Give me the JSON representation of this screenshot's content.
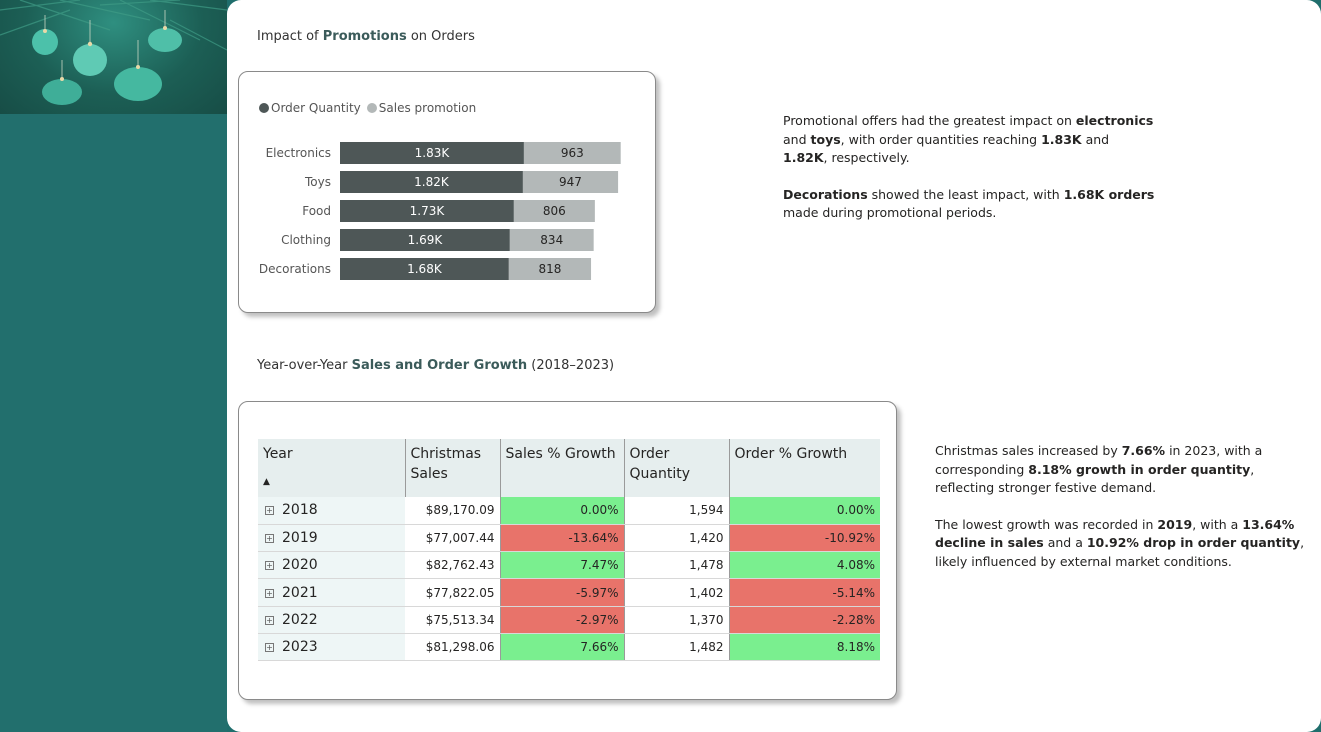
{
  "promo_section": {
    "title_pre": "Impact of ",
    "title_bold": "Promotions",
    "title_post": " on Orders"
  },
  "chart_data": {
    "type": "bar",
    "orientation": "horizontal",
    "stacked": true,
    "categories": [
      "Electronics",
      "Toys",
      "Food",
      "Clothing",
      "Decorations"
    ],
    "series": [
      {
        "name": "Order Quantity",
        "values": [
          1830,
          1820,
          1730,
          1690,
          1680
        ],
        "labels": [
          "1.83K",
          "1.82K",
          "1.73K",
          "1.69K",
          "1.68K"
        ],
        "color": "#4e5757",
        "label_color": "#ffffff"
      },
      {
        "name": "Sales promotion",
        "values": [
          963,
          947,
          806,
          834,
          818
        ],
        "labels": [
          "963",
          "947",
          "806",
          "834",
          "818"
        ],
        "color": "#b3b8b8",
        "label_color": "#252423"
      }
    ],
    "legend_position": "top-left",
    "grid": false
  },
  "promo_narrative": {
    "p1_a": "Promotional offers had the greatest impact on ",
    "p1_b": "electronics",
    "p1_c": " and ",
    "p1_d": "toys",
    "p1_e": ", with order quantities reaching ",
    "p1_f": "1.83K",
    "p1_g": " and ",
    "p1_h": "1.82K",
    "p1_i": ", respectively.",
    "p2_a": "Decorations",
    "p2_b": " showed the least impact, with ",
    "p2_c": "1.68K orders",
    "p2_d": " made during promotional periods."
  },
  "growth_section": {
    "title_pre": "Year-over-Year ",
    "title_bold": "Sales and Order Growth",
    "title_post": " (2018–2023)"
  },
  "growth_table": {
    "headers": [
      "Year",
      "Christmas Sales",
      "Sales % Growth",
      "Order Quantity",
      "Order % Growth"
    ],
    "sort_indicator": "▲",
    "expand_glyph": "+",
    "rows": [
      {
        "year": "2018",
        "sales": "$89,170.09",
        "sales_growth": "0.00%",
        "orders": "1,594",
        "order_growth": "0.00%",
        "sg": "pos",
        "og": "pos"
      },
      {
        "year": "2019",
        "sales": "$77,007.44",
        "sales_growth": "-13.64%",
        "orders": "1,420",
        "order_growth": "-10.92%",
        "sg": "neg",
        "og": "neg"
      },
      {
        "year": "2020",
        "sales": "$82,762.43",
        "sales_growth": "7.47%",
        "orders": "1,478",
        "order_growth": "4.08%",
        "sg": "pos",
        "og": "pos"
      },
      {
        "year": "2021",
        "sales": "$77,822.05",
        "sales_growth": "-5.97%",
        "orders": "1,402",
        "order_growth": "-5.14%",
        "sg": "neg",
        "og": "neg"
      },
      {
        "year": "2022",
        "sales": "$75,513.34",
        "sales_growth": "-2.97%",
        "orders": "1,370",
        "order_growth": "-2.28%",
        "sg": "neg",
        "og": "neg"
      },
      {
        "year": "2023",
        "sales": "$81,298.06",
        "sales_growth": "7.66%",
        "orders": "1,482",
        "order_growth": "8.18%",
        "sg": "pos",
        "og": "pos"
      }
    ]
  },
  "growth_narrative": {
    "p1_a": "Christmas sales increased by ",
    "p1_b": "7.66%",
    "p1_c": " in 2023, with a corresponding ",
    "p1_d": "8.18% growth in order quantity",
    "p1_e": ", reflecting stronger festive demand.",
    "p2_a": "The lowest growth was recorded in ",
    "p2_b": "2019",
    "p2_c": ", with a ",
    "p2_d": "13.64% decline in sales",
    "p2_e": " and a ",
    "p2_f": "10.92% drop in order quantity",
    "p2_g": ", likely influenced by external market conditions."
  },
  "colors": {
    "positive": "#7aef8f",
    "negative": "#e8736a",
    "sidebar": "#226f6d"
  }
}
